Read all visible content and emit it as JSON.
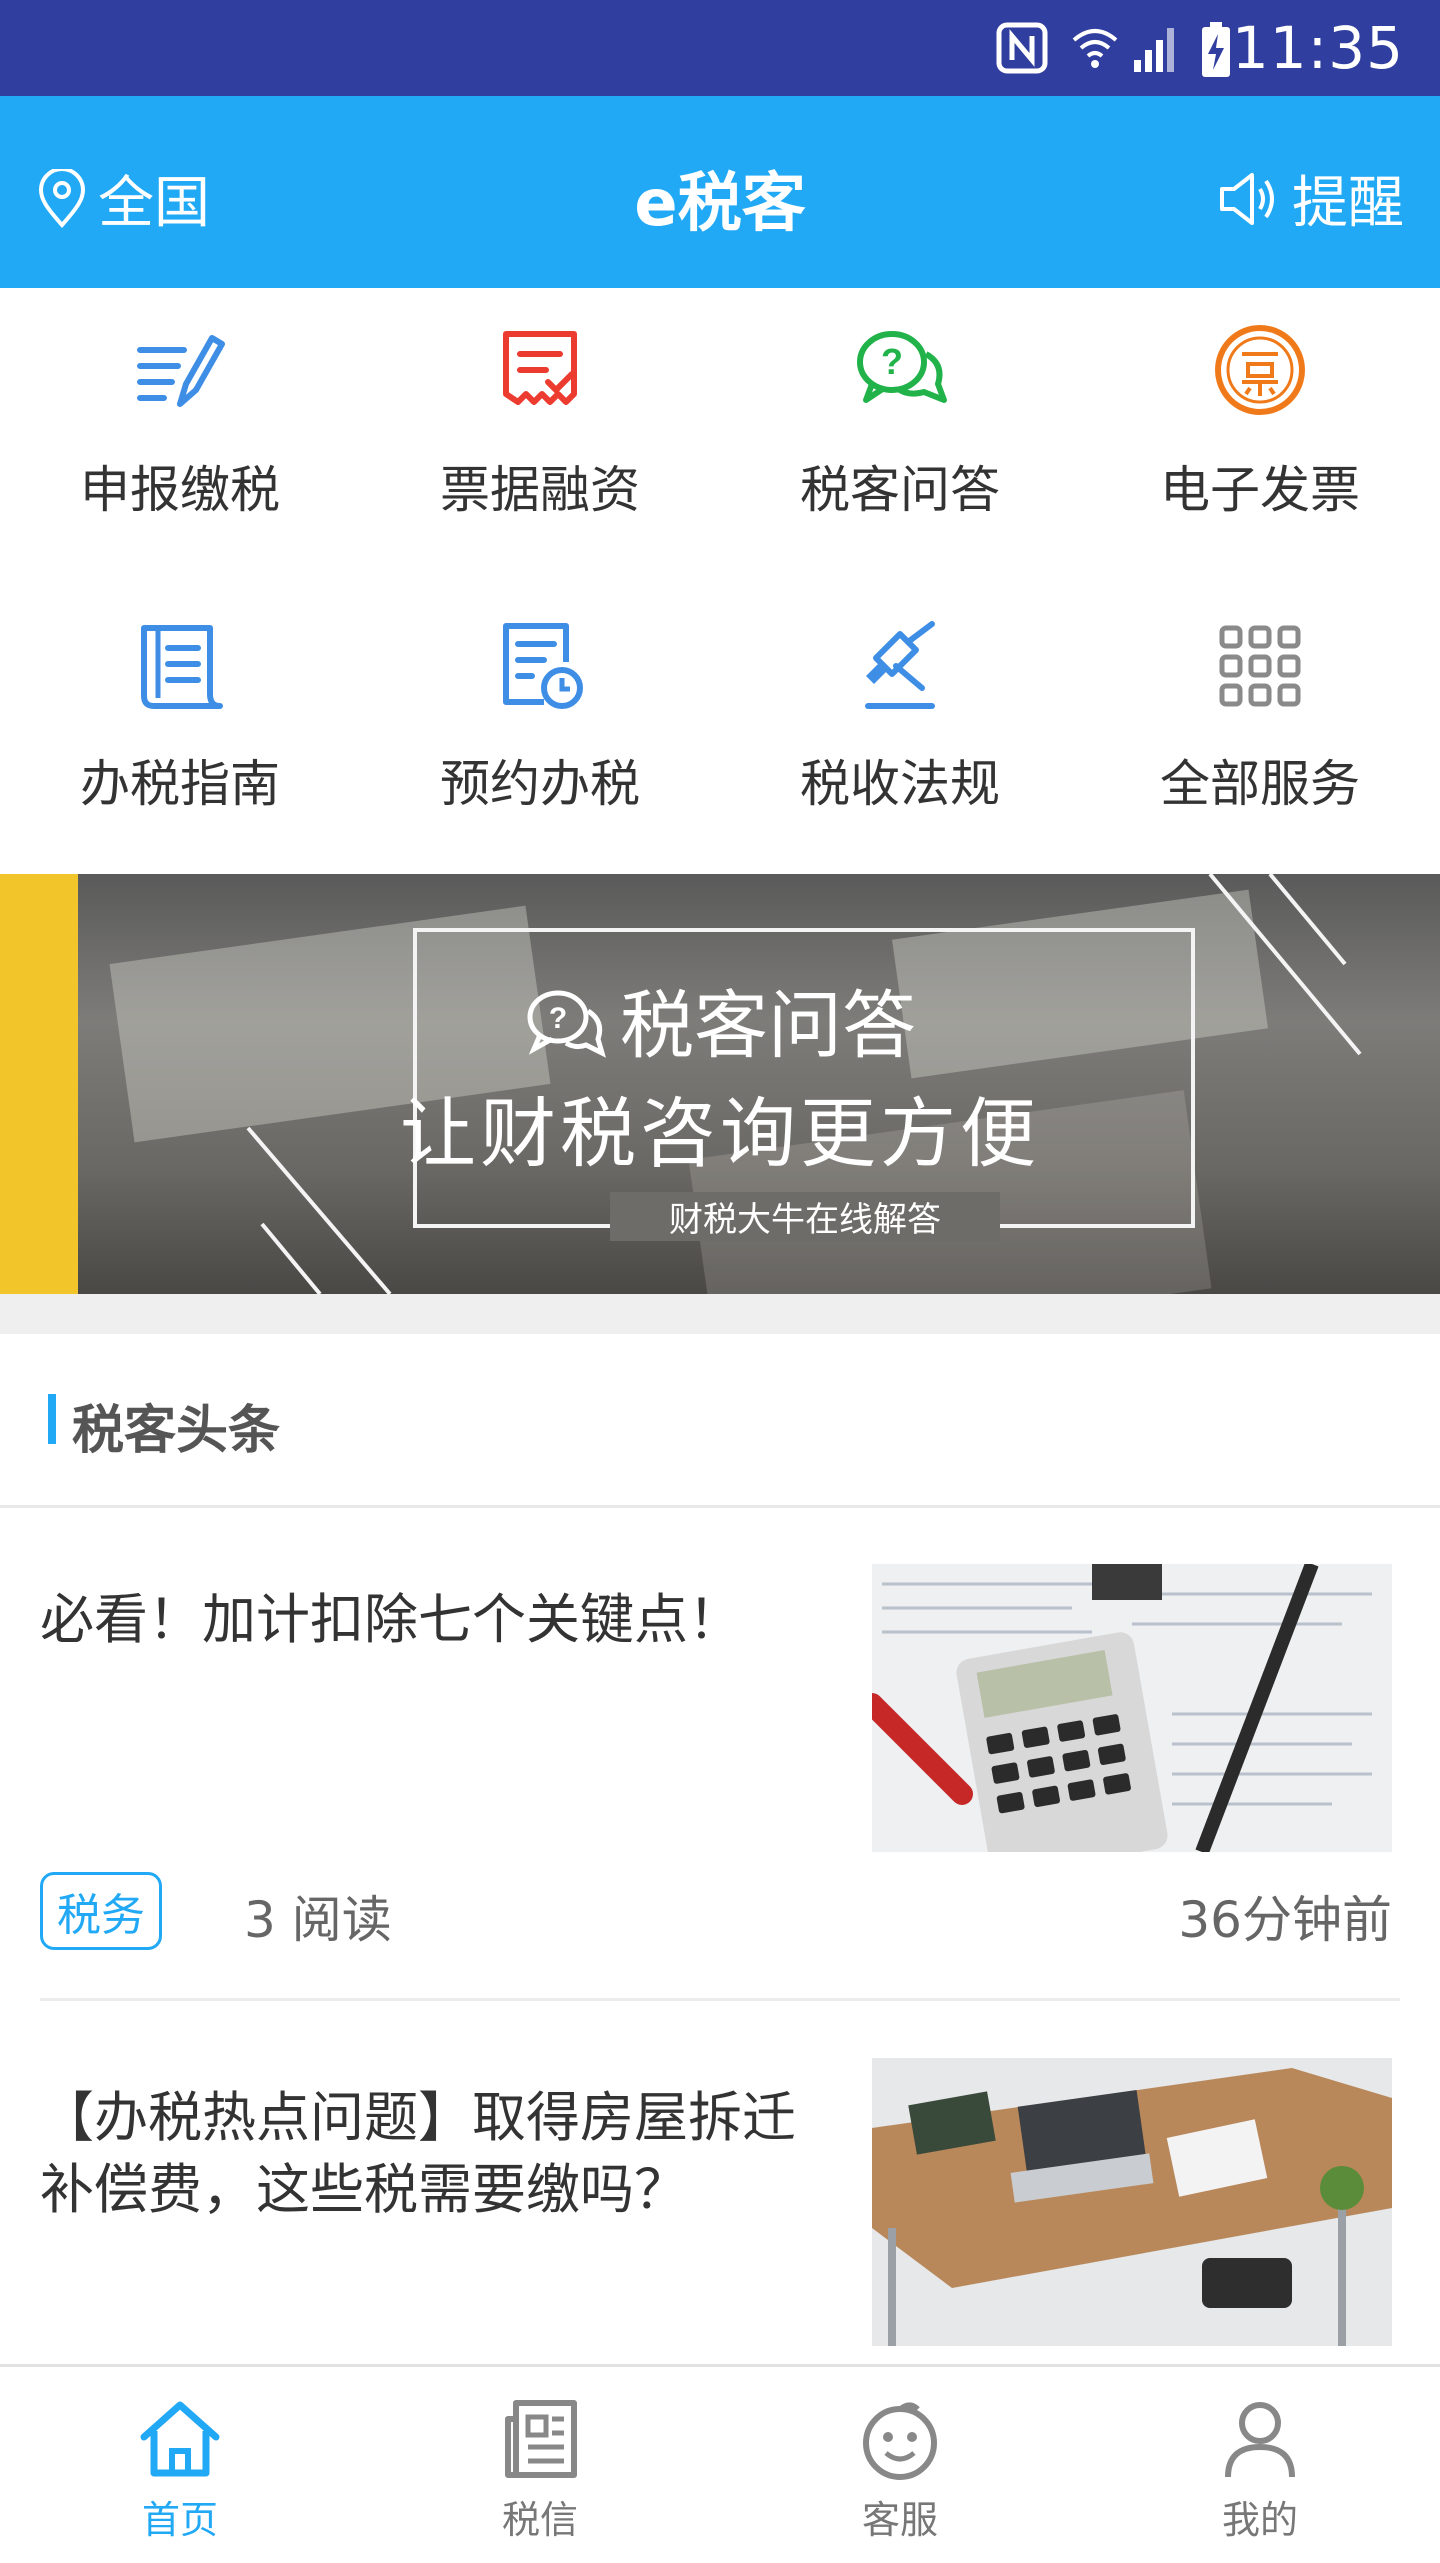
{
  "status_bar": {
    "time": "11:35"
  },
  "header": {
    "location": "全国",
    "title": "e税客",
    "remind": "提醒"
  },
  "services": [
    {
      "label": "申报缴税",
      "icon": "declare-tax-icon"
    },
    {
      "label": "票据融资",
      "icon": "bill-finance-icon"
    },
    {
      "label": "税客问答",
      "icon": "qa-chat-icon"
    },
    {
      "label": "电子发票",
      "icon": "e-invoice-icon"
    },
    {
      "label": "办税指南",
      "icon": "guide-scroll-icon"
    },
    {
      "label": "预约办税",
      "icon": "appointment-icon"
    },
    {
      "label": "税收法规",
      "icon": "law-gavel-icon"
    },
    {
      "label": "全部服务",
      "icon": "all-services-grid-icon"
    }
  ],
  "banner": {
    "line1": "税客问答",
    "line2": "让财税咨询更方便",
    "line3": "财税大牛在线解答"
  },
  "section": {
    "title": "税客头条"
  },
  "news": [
    {
      "title": "必看！加计扣除七个关键点！",
      "tag": "税务",
      "reads": "3 阅读",
      "time": "36分钟前"
    },
    {
      "title": "【办税热点问题】取得房屋拆迁补偿费，这些税需要缴吗？"
    }
  ],
  "tabs": [
    {
      "label": "首页",
      "icon": "home-icon",
      "active": true
    },
    {
      "label": "税信",
      "icon": "news-doc-icon",
      "active": false
    },
    {
      "label": "客服",
      "icon": "customer-service-icon",
      "active": false
    },
    {
      "label": "我的",
      "icon": "profile-icon",
      "active": false
    }
  ],
  "colors": {
    "status_bar": "#303f9f",
    "header": "#22a9f5",
    "accent": "#22a9f5",
    "banner_accent": "#f2c62a"
  }
}
